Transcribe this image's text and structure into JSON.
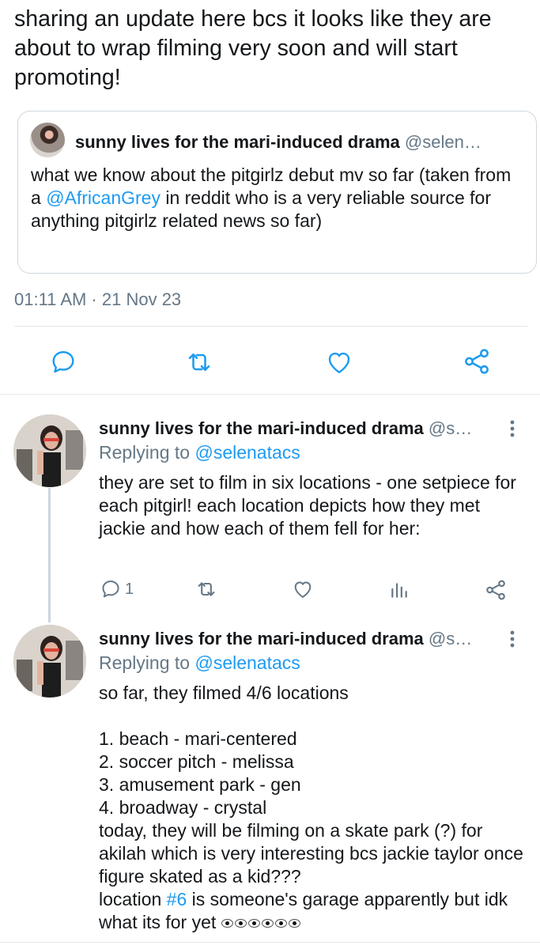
{
  "main_tweet": {
    "text": "sharing an update here bcs it looks like they are about to wrap filming very soon and will start promoting!",
    "timestamp": "01:11 AM · 21 Nov 23"
  },
  "quote": {
    "name": "sunny lives for the mari-induced drama",
    "handle": "@selen…",
    "text_1": "what we know about the pitgirlz debut mv so far (taken from a ",
    "mention": "@AfricanGrey",
    "text_2": " in reddit who is a very reliable source for anything pitgirlz related news so far)"
  },
  "replies": [
    {
      "name": "sunny lives for the mari-induced drama",
      "handle": "@s…",
      "replying_prefix": "Replying to ",
      "replying_to": "@selenatacs",
      "body": "they are set to film in six locations - one setpiece for each pitgirl! each location depicts how they met jackie and how each of them fell for her:",
      "reply_count": "1"
    },
    {
      "name": "sunny lives for the mari-induced drama",
      "handle": "@s…",
      "replying_prefix": "Replying to ",
      "replying_to": "@selenatacs",
      "body_1": "so far, they filmed 4/6 locations\n\n1. beach - mari-centered\n2. soccer pitch - melissa\n3. amusement park - gen\n4. broadway - crystal\ntoday, they will be filming on a skate park (?) for akilah which is very interesting bcs jackie taylor once figure skated as a kid???\nlocation ",
      "hashtag": "#6",
      "body_2": " is someone's garage apparently but idk what its for yet "
    }
  ],
  "icons": {
    "reply": "reply-icon",
    "retweet": "retweet-icon",
    "like": "heart-icon",
    "share": "share-icon",
    "analytics": "analytics-icon",
    "more": "more-vertical-icon",
    "emoji": "eyes-emoji"
  },
  "colors": {
    "link": "#1d9bf0",
    "secondary": "#657786",
    "text": "#14171a",
    "border": "#e1e8ed"
  }
}
